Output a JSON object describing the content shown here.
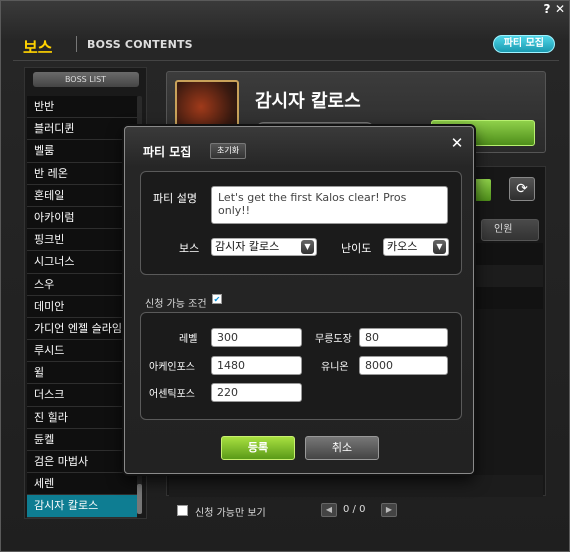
{
  "window": {
    "help_label": "?",
    "close_label": "✕"
  },
  "header": {
    "title_kr": "보스",
    "title_en": "BOSS CONTENTS",
    "recruit_label": "파티 모집"
  },
  "sidebar": {
    "header": "BOSS LIST",
    "items": [
      "반반",
      "블러디퀸",
      "벨룸",
      "반 레온",
      "혼테일",
      "아카이럼",
      "핑크빈",
      "시그너스",
      "스우",
      "데미안",
      "가디언 엔젤 슬라임",
      "루시드",
      "윌",
      "더스크",
      "진 힐라",
      "듄켈",
      "검은 마법사",
      "세렌",
      "감시자 칼로스"
    ],
    "selected_index": 18
  },
  "boss_panel": {
    "name": "감시자 칼로스"
  },
  "list": {
    "col_header": "인원"
  },
  "footer": {
    "available_only_label": "신청 가능만 보기",
    "page_text": "0 / 0"
  },
  "modal": {
    "title": "파티 모집",
    "reset_label": "초기화",
    "desc_label": "파티 설명",
    "desc_value": "Let's get the first Kalos clear! Pros only!!",
    "boss_label": "보스",
    "boss_value": "감시자 칼로스",
    "difficulty_label": "난이도",
    "difficulty_value": "카오스",
    "conditions_label": "신청 가능 조건",
    "conditions_checked": true,
    "fields": {
      "level_label": "레벨",
      "level_value": "300",
      "mureung_label": "무릉도장",
      "mureung_value": "80",
      "arcane_label": "아케인포스",
      "arcane_value": "1480",
      "union_label": "유니온",
      "union_value": "8000",
      "authentic_label": "어센틱포스",
      "authentic_value": "220"
    },
    "submit_label": "등록",
    "cancel_label": "취소"
  }
}
